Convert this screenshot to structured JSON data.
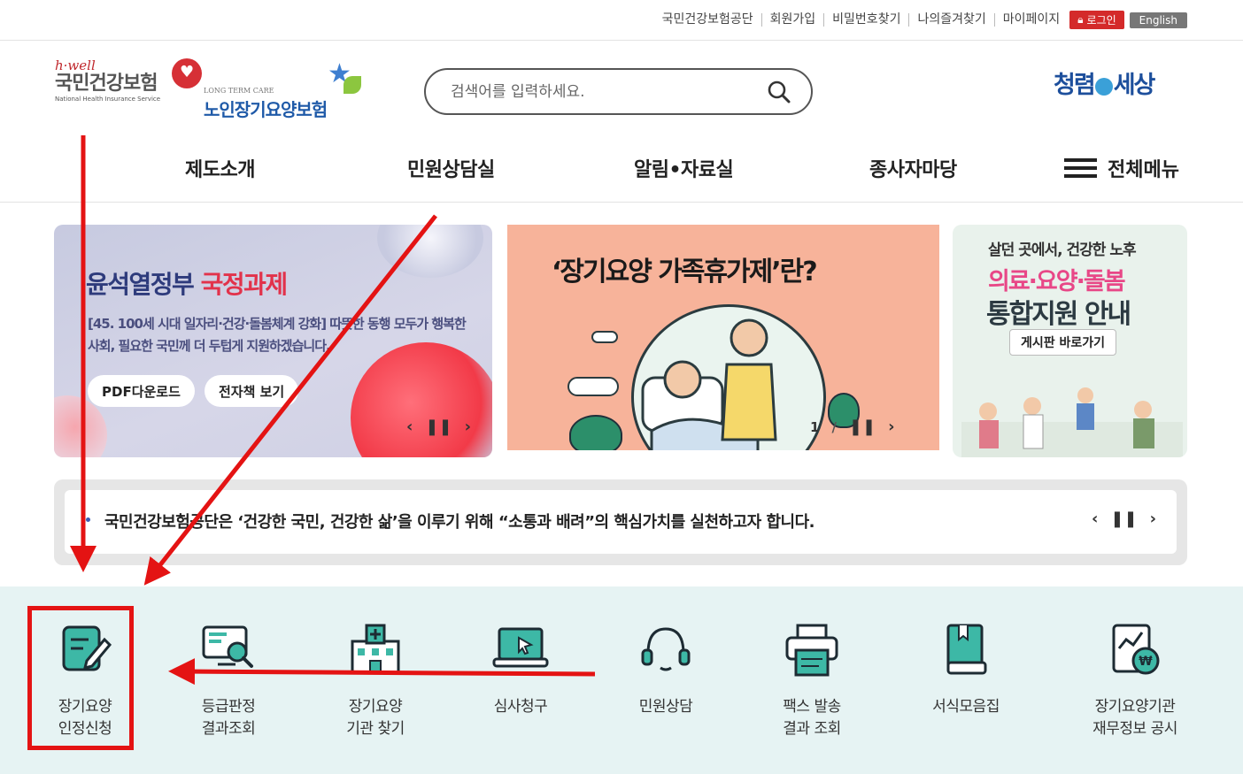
{
  "util": {
    "links": [
      "국민건강보험공단",
      "회원가입",
      "비밀번호찾기",
      "나의즐겨찾기",
      "마이페이지"
    ],
    "login": "로그인",
    "english": "English"
  },
  "logos": {
    "hwell_tag": "h·well",
    "nhis_kr": "국민건강보험",
    "nhis_en": "National Health Insurance Service",
    "ltc_en": "LONG TERM CARE",
    "ltc_kr": "노인장기요양보험"
  },
  "search": {
    "placeholder": "검색어를 입력하세요."
  },
  "slogan": {
    "left": "청렴",
    "right": "세상"
  },
  "gnb": {
    "items": [
      "제도소개",
      "민원상담실",
      "알림•자료실",
      "종사자마당"
    ],
    "all_menu": "전체메뉴"
  },
  "banners": {
    "b1": {
      "title_a": "윤석열정부",
      "title_b": "국정과제",
      "desc": "[45. 100세 시대 일자리·건강·돌봄체계 강화] 따뜻한 동행 모두가 행복한 사회, 필요한 국민께 더 두텁게 지원하겠습니다.",
      "btn_pdf": "PDF다운로드",
      "btn_ebook": "전자책 보기"
    },
    "b2": {
      "title": "‘장기요양 가족휴가제’란?",
      "page": "1"
    },
    "b3": {
      "line1": "살던 곳에서, 건강한 노후",
      "line2": "의료·요양·돌봄",
      "line3": "통합지원 안내",
      "btn": "게시판 바로가기"
    }
  },
  "notice": {
    "text": "국민건강보험공단은 ‘건강한 국민, 건강한 삶’을 이루기 위해 “소통과 배려”의 핵심가치를 실천하고자 합니다."
  },
  "quick": [
    {
      "label": "장기요양\n인정신청",
      "icon": "application-pen-icon"
    },
    {
      "label": "등급판정\n결과조회",
      "icon": "monitor-search-icon"
    },
    {
      "label": "장기요양\n기관 찾기",
      "icon": "hospital-building-icon"
    },
    {
      "label": "심사청구",
      "icon": "laptop-cursor-icon"
    },
    {
      "label": "민원상담",
      "icon": "headset-icon"
    },
    {
      "label": "팩스 발송\n결과 조회",
      "icon": "fax-printer-icon"
    },
    {
      "label": "서식모음집",
      "icon": "book-icon"
    },
    {
      "label": "장기요양기관\n재무정보 공시",
      "icon": "financial-document-icon"
    }
  ],
  "colors": {
    "accent_teal": "#1a9a8f",
    "quick_bg": "#e6f3f3",
    "annotation_red": "#e41313",
    "brand_red": "#d42a2a"
  }
}
